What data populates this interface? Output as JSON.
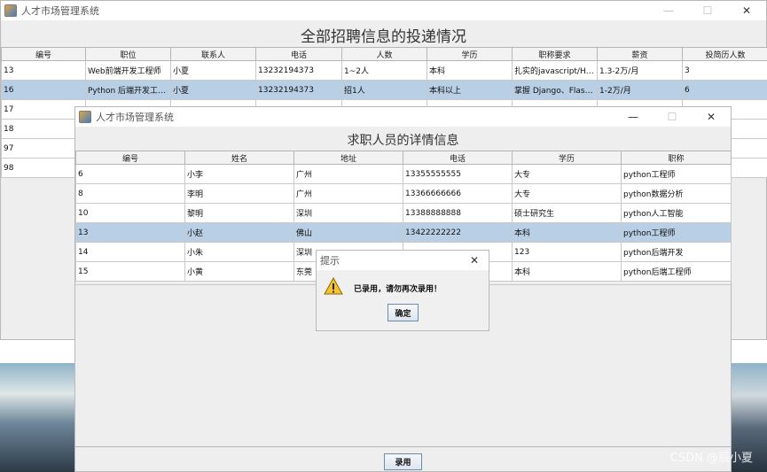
{
  "main_window": {
    "title": "人才市场管理系统",
    "heading": "全部招聘信息的投递情况",
    "controls": [
      "—",
      "☐",
      "✕"
    ],
    "columns": [
      "编号",
      "职位",
      "联系人",
      "电话",
      "人数",
      "学历",
      "职称要求",
      "薪资",
      "投简历人数"
    ],
    "rows": [
      [
        "13",
        "Web前端开发工程师",
        "小夏",
        "13232194373",
        "1~2人",
        "本科",
        "扎实的javascript/HTM...",
        "1.3-2万/月",
        "3"
      ],
      [
        "16",
        "Python 后端开发工程师",
        "小夏",
        "13232194373",
        "招1人",
        "本科以上",
        "掌握 Django、Flask...",
        "1-2万/月",
        "6"
      ],
      [
        "17",
        "",
        "",
        "",
        "",
        "",
        "",
        "",
        ""
      ],
      [
        "18",
        "",
        "",
        "",
        "",
        "",
        "",
        "",
        ""
      ],
      [
        "97",
        "",
        "",
        "",
        "",
        "",
        "",
        "",
        ""
      ],
      [
        "98",
        "",
        "",
        "",
        "",
        "",
        "",
        "",
        ""
      ]
    ],
    "selected_row": 1
  },
  "detail_window": {
    "title": "人才市场管理系统",
    "heading": "求职人员的详情信息",
    "controls": [
      "—",
      "☐",
      "✕"
    ],
    "columns": [
      "编号",
      "姓名",
      "地址",
      "电话",
      "学历",
      "职称"
    ],
    "rows": [
      [
        "6",
        "小李",
        "广州",
        "13355555555",
        "大专",
        "python工程师"
      ],
      [
        "8",
        "李明",
        "广州",
        "13366666666",
        "大专",
        "python数据分析"
      ],
      [
        "10",
        "黎明",
        "深圳",
        "13388888888",
        "硕士研究生",
        "python人工智能"
      ],
      [
        "13",
        "小赵",
        "佛山",
        "13422222222",
        "本科",
        "python工程师"
      ],
      [
        "14",
        "小朱",
        "深圳",
        "",
        "123",
        "python后端开发"
      ],
      [
        "15",
        "小黄",
        "东莞",
        "",
        "本科",
        "python后端工程师"
      ]
    ],
    "selected_row": 3,
    "hire_button": "录用"
  },
  "dialog": {
    "title": "提示",
    "message": "已录用，请勿再次录用！",
    "ok_button": "确定",
    "close": "✕"
  },
  "watermark": "CSDN @辰小夏"
}
